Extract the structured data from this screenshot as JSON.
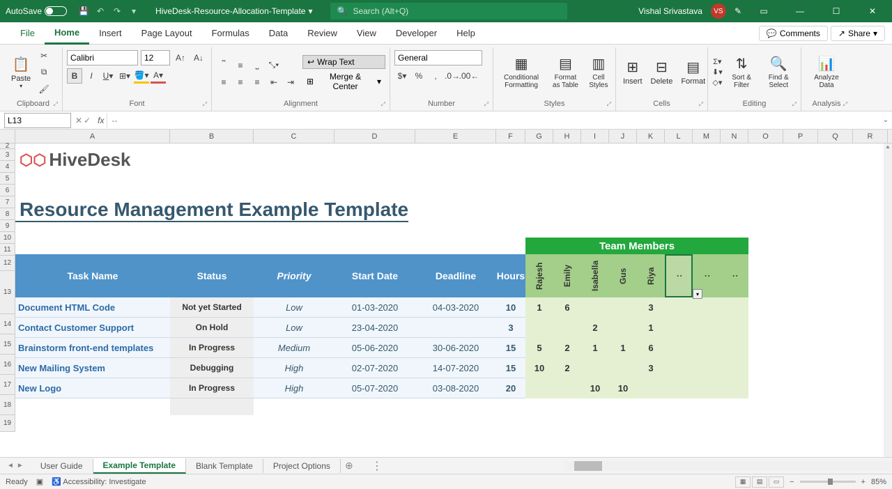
{
  "title": {
    "autosave": "AutoSave",
    "autosave_off": "Off",
    "doc": "HiveDesk-Resource-Allocation-Template",
    "search_placeholder": "Search (Alt+Q)",
    "user": "Vishal Srivastava",
    "user_initials": "VS"
  },
  "tabs": {
    "file": "File",
    "home": "Home",
    "insert": "Insert",
    "pagelayout": "Page Layout",
    "formulas": "Formulas",
    "data": "Data",
    "review": "Review",
    "view": "View",
    "developer": "Developer",
    "help": "Help",
    "comments": "Comments",
    "share": "Share"
  },
  "ribbon": {
    "clipboard": {
      "paste": "Paste",
      "label": "Clipboard"
    },
    "font": {
      "name": "Calibri",
      "size": "12",
      "label": "Font"
    },
    "alignment": {
      "wrap": "Wrap Text",
      "merge": "Merge & Center",
      "label": "Alignment"
    },
    "number": {
      "format": "General",
      "label": "Number"
    },
    "styles": {
      "cond": "Conditional Formatting",
      "fmtas": "Format as Table",
      "cell": "Cell Styles",
      "label": "Styles"
    },
    "cells": {
      "insert": "Insert",
      "delete": "Delete",
      "format": "Format",
      "label": "Cells"
    },
    "editing": {
      "sort": "Sort & Filter",
      "find": "Find & Select",
      "label": "Editing"
    },
    "analysis": {
      "analyze": "Analyze Data",
      "label": "Analysis"
    }
  },
  "fx": {
    "name_box": "L13",
    "formula": "--"
  },
  "cols": [
    "A",
    "B",
    "C",
    "D",
    "E",
    "F",
    "G",
    "H",
    "I",
    "J",
    "K",
    "L",
    "M",
    "N",
    "O",
    "P",
    "Q",
    "R"
  ],
  "rows": [
    "2",
    "3",
    "4",
    "5",
    "6",
    "7",
    "8",
    "9",
    "10",
    "11",
    "12",
    "13",
    "14",
    "15",
    "16",
    "17",
    "18",
    "19"
  ],
  "content": {
    "logo": "HiveDesk",
    "heading": "Resource Management Example Template",
    "team_title": "Team Members",
    "members": [
      "Rajesh",
      "Emily",
      "Isabella",
      "Gus",
      "Riya",
      ":",
      ":",
      ":"
    ],
    "headers": {
      "task": "Task Name",
      "status": "Status",
      "priority": "Priority",
      "start": "Start Date",
      "deadline": "Deadline",
      "hours": "Hours"
    },
    "tasks": [
      {
        "name": "Document HTML Code",
        "status": "Not yet Started",
        "priority": "Low",
        "start": "01-03-2020",
        "deadline": "04-03-2020",
        "hours": "10",
        "alloc": [
          "1",
          "6",
          "",
          "",
          "3",
          "",
          "",
          ""
        ]
      },
      {
        "name": "Contact Customer Support",
        "status": "On Hold",
        "priority": "Low",
        "start": "23-04-2020",
        "deadline": "",
        "hours": "3",
        "alloc": [
          "",
          "",
          "2",
          "",
          "1",
          "",
          "",
          ""
        ]
      },
      {
        "name": "Brainstorm front-end templates",
        "status": "In Progress",
        "priority": "Medium",
        "start": "05-06-2020",
        "deadline": "30-06-2020",
        "hours": "15",
        "alloc": [
          "5",
          "2",
          "1",
          "1",
          "6",
          "",
          "",
          ""
        ]
      },
      {
        "name": "New Mailing System",
        "status": "Debugging",
        "priority": "High",
        "start": "02-07-2020",
        "deadline": "14-07-2020",
        "hours": "15",
        "alloc": [
          "10",
          "2",
          "",
          "",
          "3",
          "",
          "",
          ""
        ]
      },
      {
        "name": "New Logo",
        "status": "In Progress",
        "priority": "High",
        "start": "05-07-2020",
        "deadline": "03-08-2020",
        "hours": "20",
        "alloc": [
          "",
          "",
          "10",
          "10",
          "",
          "",
          "",
          ""
        ]
      }
    ]
  },
  "sheets": {
    "s1": "User Guide",
    "s2": "Example Template",
    "s3": "Blank Template",
    "s4": "Project Options"
  },
  "status": {
    "ready": "Ready",
    "access": "Accessibility: Investigate",
    "zoom": "85%"
  }
}
